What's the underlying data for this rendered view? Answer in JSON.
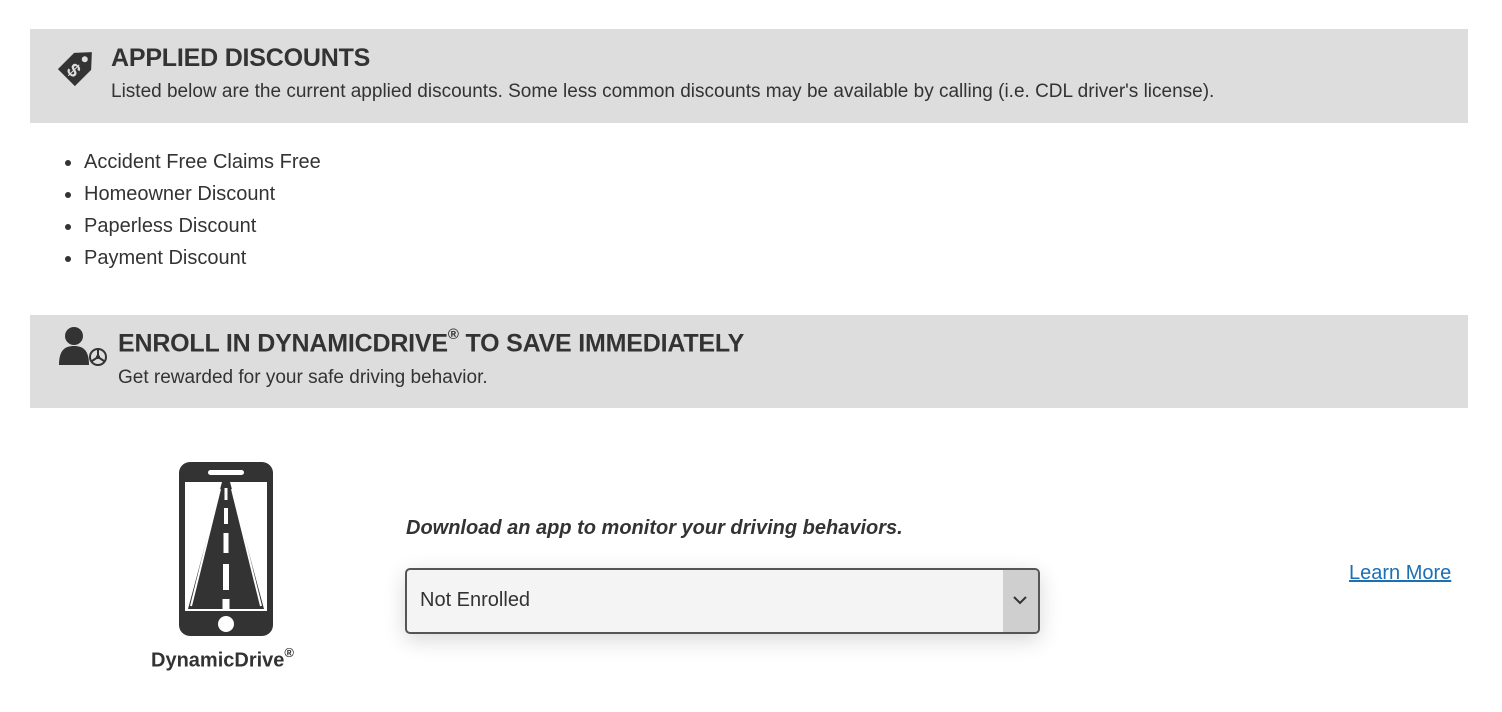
{
  "discounts_section": {
    "title": "APPLIED DISCOUNTS",
    "subtitle": "Listed below are the current applied discounts. Some less common discounts may be available by calling (i.e. CDL driver's license).",
    "icon": "price-tag-dollar-icon",
    "items": [
      "Accident Free Claims Free",
      "Homeowner Discount",
      "Paperless Discount",
      "Payment Discount"
    ]
  },
  "enroll_section": {
    "title_main": "ENROLL IN DYNAMICDRIVE",
    "title_reg": "®",
    "title_rest": " TO SAVE IMMEDIATELY",
    "subtitle": "Get rewarded for your safe driving behavior.",
    "icon": "driver-steering-wheel-icon"
  },
  "program": {
    "name": "DynamicDrive",
    "reg": "®",
    "icon": "phone-road-icon",
    "prompt": "Download an app to monitor your driving behaviors.",
    "enrollment_select": {
      "selected": "Not Enrolled"
    },
    "learn_more_label": "Learn More"
  },
  "colors": {
    "banner_bg": "#dddddd",
    "text": "#333333",
    "link": "#1a6fb5"
  }
}
